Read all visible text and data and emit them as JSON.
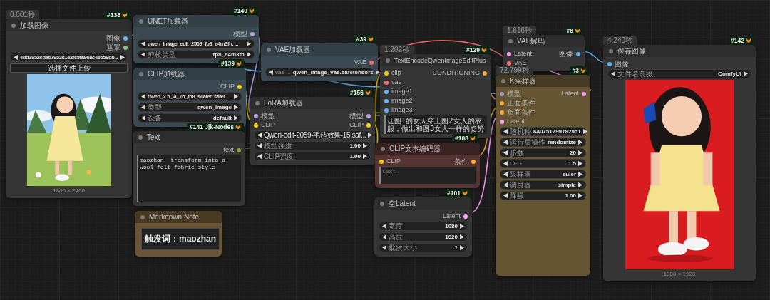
{
  "nodes": [
    {
      "badge": "#138",
      "timing": "0.001秒",
      "title": "加载图像",
      "color": "#353535",
      "rows": [
        {
          "kind": "slot",
          "output": {
            "label": "图像",
            "color": "#64b5f6"
          }
        },
        {
          "kind": "slot",
          "output": {
            "label": "遮罩",
            "color": "#81c784"
          }
        },
        {
          "kind": "combo",
          "value": "4dd3952cda67952c1e2fc5fa96ac4e658db..."
        },
        {
          "kind": "button",
          "label": "选择文件上传"
        },
        {
          "kind": "picture"
        },
        {
          "kind": "caption",
          "text": "1800 × 2400"
        }
      ]
    },
    {
      "badge": "#140",
      "title": "UNET加载器",
      "color": "#3b4a52",
      "rows": [
        {
          "kind": "slot",
          "output": {
            "label": "模型",
            "color": "#b39ddb"
          }
        },
        {
          "kind": "combo",
          "value": "qwen_image_edit_2509_fp8_e4m3fn. ..."
        },
        {
          "kind": "combo",
          "label": "剪枝类型",
          "value": "fp8_e4m3fn"
        }
      ]
    },
    {
      "badge": "#139",
      "title": "CLIP加载器",
      "color": "#3b4a52",
      "rows": [
        {
          "kind": "slot",
          "output": {
            "label": "CLIP",
            "color": "#ffd500"
          }
        },
        {
          "kind": "combo",
          "value": "qwen_2.5_vl_7b_fp8_scaled.safet ..."
        },
        {
          "kind": "combo",
          "label": "类型",
          "value": "qwen_image"
        },
        {
          "kind": "combo",
          "label": "设备",
          "value": "default"
        }
      ]
    },
    {
      "badge": "#141 Jjk-Nodes",
      "title": "Text",
      "color": "#353535",
      "rows": [
        {
          "kind": "slot",
          "output": {
            "label": "text",
            "color": "#7cb342"
          }
        },
        {
          "kind": "textarea",
          "value": "maozhan, transform into a wool felt fabric style"
        }
      ]
    },
    {
      "title": "Markdown Note",
      "color": "#6a5433",
      "rows": [
        {
          "kind": "markdown",
          "text": "触发词：maozhan"
        }
      ]
    },
    {
      "badge": "#39",
      "title": "VAE加载器",
      "color": "#3b4a52",
      "rows": [
        {
          "kind": "slot",
          "output": {
            "label": "VAE",
            "color": "#ff6e6e"
          }
        },
        {
          "kind": "combo",
          "label": "vae ...",
          "value": "qwen_image_vae.safetensors"
        }
      ]
    },
    {
      "badge": "#156",
      "title": "LoRA加载器",
      "color": "#353535",
      "rows": [
        {
          "kind": "slot",
          "input": {
            "label": "模型",
            "color": "#b39ddb"
          },
          "output": {
            "label": "模型",
            "color": "#b39ddb"
          }
        },
        {
          "kind": "slot",
          "input": {
            "label": "CLIP",
            "color": "#ffd500"
          },
          "output": {
            "label": "CLIP",
            "color": "#ffd500"
          }
        },
        {
          "kind": "combo",
          "value": "Qwen-edit-2059-毛毡效果-15.saf..."
        },
        {
          "kind": "combo",
          "label": "模型强度",
          "value": "1.00"
        },
        {
          "kind": "combo",
          "label": "CLIP强度",
          "value": "1.00"
        }
      ]
    },
    {
      "badge": "#129",
      "timing": "1.202秒",
      "title": "TextEncodeQwenImageEditPlus",
      "color": "#353535",
      "rows": [
        {
          "kind": "slot",
          "input": {
            "label": "clip",
            "color": "#ffd500"
          },
          "output": {
            "label": "CONDITIONING",
            "color": "#ffa931"
          }
        },
        {
          "kind": "slot",
          "input": {
            "label": "vae",
            "color": "#ff6e6e"
          }
        },
        {
          "kind": "slot",
          "input": {
            "label": "image1",
            "color": "#64b5f6"
          }
        },
        {
          "kind": "slot",
          "input": {
            "label": "image2",
            "color": "#64b5f6"
          }
        },
        {
          "kind": "slot",
          "input": {
            "label": "image3",
            "color": "#64b5f6"
          }
        },
        {
          "kind": "textarea",
          "value": "让图1的女人穿上图2女人的衣服，做出和图3女人一样的姿势"
        }
      ]
    },
    {
      "badge": "#108",
      "title": "CLIP文本编码器",
      "color": "#553434",
      "rows": [
        {
          "kind": "slot",
          "input": {
            "label": "CLIP",
            "color": "#ffd500"
          },
          "output": {
            "label": "条件",
            "color": "#ffa931"
          }
        },
        {
          "kind": "textarea",
          "placeholder": "text"
        }
      ]
    },
    {
      "badge": "#101",
      "title": "空Latent",
      "color": "#353535",
      "rows": [
        {
          "kind": "slot",
          "output": {
            "label": "Latent",
            "color": "#ff9cf9"
          }
        },
        {
          "kind": "combo",
          "label": "宽度",
          "value": "1080"
        },
        {
          "kind": "combo",
          "label": "高度",
          "value": "1920"
        },
        {
          "kind": "combo",
          "label": "批次大小",
          "value": "1"
        }
      ]
    },
    {
      "badge": "#8",
      "timing": "1.616秒",
      "title": "VAE解码",
      "color": "#353535",
      "rows": [
        {
          "kind": "slot",
          "input": {
            "label": "Latent",
            "color": "#ff9cf9"
          },
          "output": {
            "label": "图像",
            "color": "#64b5f6"
          }
        },
        {
          "kind": "slot",
          "input": {
            "label": "VAE",
            "color": "#ff6e6e"
          }
        }
      ]
    },
    {
      "badge": "#3",
      "timing": "72.799秒",
      "title": "K采样器",
      "color": "#665533",
      "rows": [
        {
          "kind": "slot",
          "input": {
            "label": "模型",
            "color": "#b39ddb"
          },
          "output": {
            "label": "Latent",
            "color": "#ff9cf9"
          }
        },
        {
          "kind": "slot",
          "input": {
            "label": "正面条件",
            "color": "#ffa931"
          }
        },
        {
          "kind": "slot",
          "input": {
            "label": "负面条件",
            "color": "#ffa931"
          }
        },
        {
          "kind": "slot",
          "input": {
            "label": "Latent",
            "color": "#ff9cf9"
          }
        },
        {
          "kind": "combo",
          "label": "随机种",
          "value": "640751799782951"
        },
        {
          "kind": "combo",
          "label": "运行后操作",
          "value": "randomize"
        },
        {
          "kind": "combo",
          "label": "步数",
          "value": "20"
        },
        {
          "kind": "combo",
          "label": "CFG",
          "value": "1.5"
        },
        {
          "kind": "combo",
          "label": "采样器",
          "value": "euler"
        },
        {
          "kind": "combo",
          "label": "调度器",
          "value": "simple"
        },
        {
          "kind": "combo",
          "label": "降噪",
          "value": "1.00"
        }
      ]
    },
    {
      "badge": "#142",
      "timing": "4.240秒",
      "title": "保存图像",
      "color": "#353535",
      "rows": [
        {
          "kind": "slot",
          "input": {
            "label": "图像",
            "color": "#64b5f6"
          }
        },
        {
          "kind": "combo",
          "label": "文件名前缀",
          "value": "ComfyUI"
        },
        {
          "kind": "picture"
        },
        {
          "kind": "caption",
          "text": "1080 × 1920"
        }
      ]
    }
  ]
}
